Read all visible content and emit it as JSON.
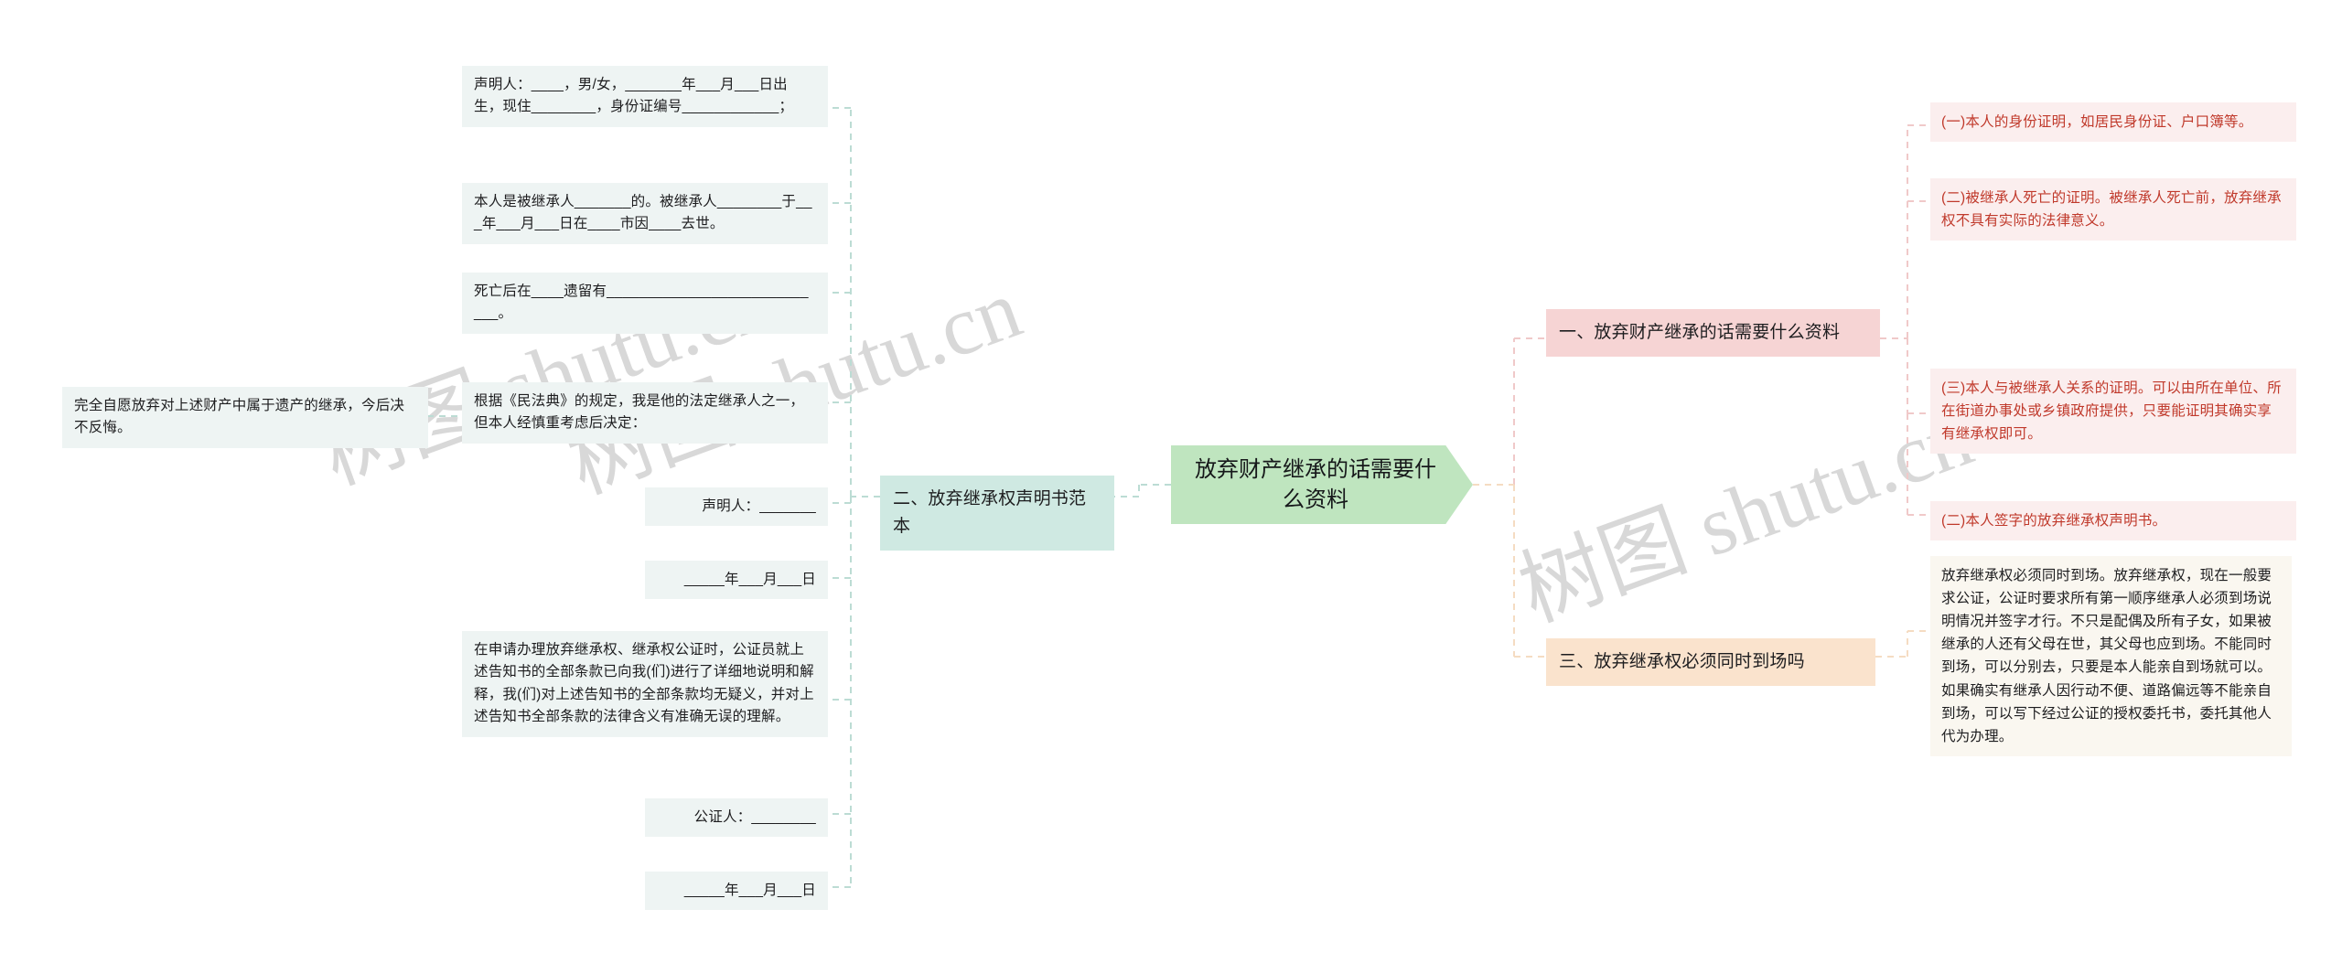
{
  "title": "放弃财产继承的话需要什么资料",
  "watermarks": [
    "树图 shutu.cn",
    "树图 shutu.cn",
    "树图 shutu.cn"
  ],
  "colors": {
    "center_fill": "#bfe5bf",
    "teal_chip": "#cfe9e2",
    "pink_chip": "#f6d4d4",
    "orange_chip": "#fae3cd",
    "doc_fill": "#eef4f3",
    "red_text": "#c0392b",
    "cream_fill": "#faf7f0",
    "wire_teal": "#bcdcd4",
    "wire_pink": "#f0c9c9",
    "wire_orange": "#f5dcc2"
  },
  "center": {
    "label": "放弃财产继承的话需要什么资料"
  },
  "branches": [
    {
      "id": "branch-1",
      "label": "一、放弃财产继承的话需要什么资料",
      "color": "pink",
      "children": [
        "(一)本人的身份证明，如居民身份证、户口簿等。",
        "(二)被继承人死亡的证明。被继承人死亡前，放弃继承权不具有实际的法律意义。",
        "(三)本人与被继承人关系的证明。可以由所在单位、所在街道办事处或乡镇政府提供，只要能证明其确实享有继承权即可。",
        "(二)本人签字的放弃继承权声明书。"
      ]
    },
    {
      "id": "branch-2",
      "label": "二、放弃继承权声明书范本",
      "color": "teal",
      "children": [
        "声明人：____，男/女，_______年___月___日出生，现住________，身份证编号____________；",
        "本人是被继承人_______的。被继承人________于___年___月___日在____市因____去世。",
        "死亡后在____遗留有____________________________。",
        "根据《民法典》的规定，我是他的法定继承人之一，但本人经慎重考虑后决定：",
        "声明人：_______",
        "_____年___月___日",
        "在申请办理放弃继承权、继承权公证时，公证员就上述告知书的全部条款已向我(们)进行了详细地说明和解释，我(们)对上述告知书的全部条款均无疑义，并对上述告知书全部条款的法律含义有准确无误的理解。",
        "公证人：________",
        "_____年___月___日"
      ],
      "grandchild": "完全自愿放弃对上述财产中属于遗产的继承，今后决不反悔。"
    },
    {
      "id": "branch-3",
      "label": "三、放弃继承权必须同时到场吗",
      "color": "orange",
      "children": [
        "放弃继承权必须同时到场。放弃继承权，现在一般要求公证，公证时要求所有第一顺序继承人必须到场说明情况并签字才行。不只是配偶及所有子女，如果被继承的人还有父母在世，其父母也应到场。不能同时到场，可以分别去，只要是本人能亲自到场就可以。如果确实有继承人因行动不便、道路偏远等不能亲自到场，可以写下经过公证的授权委托书，委托其他人代为办理。"
      ]
    }
  ]
}
